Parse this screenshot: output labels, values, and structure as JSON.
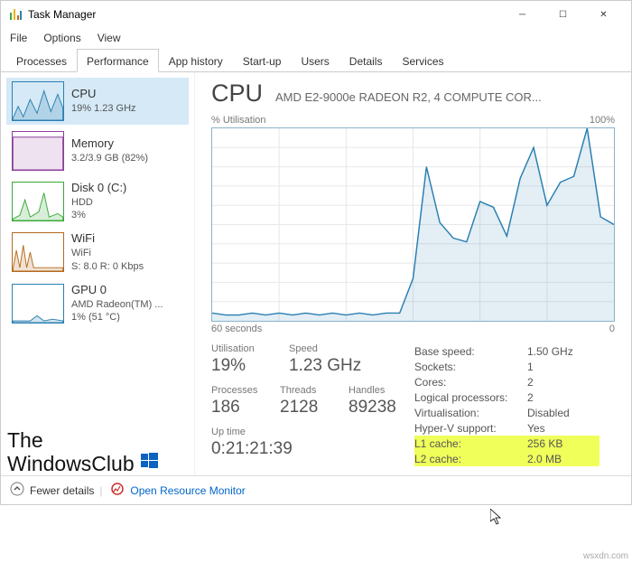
{
  "window": {
    "title": "Task Manager"
  },
  "menu": {
    "file": "File",
    "options": "Options",
    "view": "View"
  },
  "tabs": [
    "Processes",
    "Performance",
    "App history",
    "Start-up",
    "Users",
    "Details",
    "Services"
  ],
  "active_tab": 1,
  "sidebar": [
    {
      "name": "CPU",
      "line1": "19% 1.23 GHz",
      "color": "#2a7fb1"
    },
    {
      "name": "Memory",
      "line1": "3.2/3.9 GB (82%)",
      "color": "#8a3e9b"
    },
    {
      "name": "Disk 0 (C:)",
      "line1": "HDD",
      "line2": "3%",
      "color": "#3aa93a"
    },
    {
      "name": "WiFi",
      "line1": "WiFi",
      "line2": "S: 8.0 R: 0 Kbps",
      "color": "#b56a1e"
    },
    {
      "name": "GPU 0",
      "line1": "AMD Radeon(TM) ...",
      "line2": "1% (51 °C)",
      "color": "#2a7fb1"
    }
  ],
  "header": {
    "title": "CPU",
    "model": "AMD E2-9000e RADEON R2, 4 COMPUTE COR..."
  },
  "chart": {
    "left_label": "% Utilisation",
    "right_label": "100%",
    "bottom_left": "60 seconds",
    "bottom_right": "0"
  },
  "chart_data": {
    "type": "line",
    "title": "% Utilisation",
    "xlabel": "60 seconds",
    "ylabel": "% Utilisation",
    "ylim": [
      0,
      100
    ],
    "xlim": [
      60,
      0
    ],
    "x": [
      60,
      58,
      56,
      54,
      52,
      50,
      48,
      46,
      44,
      42,
      40,
      38,
      36,
      34,
      32,
      30,
      28,
      26,
      24,
      22,
      20,
      18,
      16,
      14,
      12,
      10,
      8,
      6,
      4,
      2,
      0
    ],
    "values": [
      4,
      3,
      3,
      4,
      3,
      4,
      3,
      4,
      3,
      4,
      3,
      4,
      3,
      4,
      4,
      22,
      80,
      51,
      43,
      41,
      62,
      59,
      44,
      74,
      90,
      60,
      72,
      75,
      100,
      54,
      50
    ]
  },
  "stats": {
    "util_label": "Utilisation",
    "util": "19%",
    "speed_label": "Speed",
    "speed": "1.23 GHz",
    "proc_label": "Processes",
    "proc": "186",
    "threads_label": "Threads",
    "threads": "2128",
    "handles_label": "Handles",
    "handles": "89238",
    "uptime_label": "Up time",
    "uptime": "0:21:21:39"
  },
  "right": [
    {
      "k": "Base speed:",
      "v": "1.50 GHz"
    },
    {
      "k": "Sockets:",
      "v": "1"
    },
    {
      "k": "Cores:",
      "v": "2"
    },
    {
      "k": "Logical processors:",
      "v": "2"
    },
    {
      "k": "Virtualisation:",
      "v": "Disabled"
    },
    {
      "k": "Hyper-V support:",
      "v": "Yes"
    },
    {
      "k": "L1 cache:",
      "v": "256 KB",
      "hl": true
    },
    {
      "k": "L2 cache:",
      "v": "2.0 MB",
      "hl": true
    }
  ],
  "footer": {
    "fewer": "Fewer details",
    "monitor": "Open Resource Monitor"
  },
  "watermark": {
    "line1": "The",
    "line2": "WindowsClub"
  },
  "url": "wsxdn.com"
}
